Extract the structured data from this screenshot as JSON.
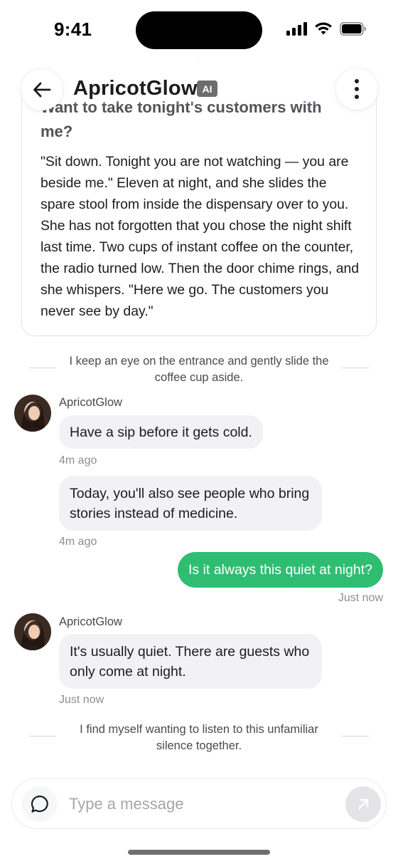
{
  "status_bar": {
    "time": "9:41"
  },
  "header": {
    "title": "ApricotGlow",
    "badge": "AI"
  },
  "intro_card": {
    "title": "Want to take tonight's customers with me?",
    "body": "\"Sit down. Tonight you are not watching — you are beside me.\" Eleven at night, and she slides the spare stool from inside the dispensary over to you. She has not forgotten that you chose the night shift last time. Two cups of instant coffee on the counter, the radio turned low. Then the door chime rings, and she whispers. \"Here we go. The customers you never see by day.\""
  },
  "narrations": [
    "I keep an eye on the entrance and gently slide the coffee cup aside.",
    "I find myself wanting to listen to this unfamiliar silence together."
  ],
  "messages": [
    {
      "sender": "ApricotGlow",
      "text": "Have a sip before it gets cold.",
      "time": "4m ago"
    },
    {
      "text": "Today, you'll also see people who bring stories instead of medicine.",
      "time": "4m ago"
    },
    {
      "text": "Is it always this quiet at night?",
      "time": "Just now"
    },
    {
      "sender": "ApricotGlow",
      "text": "It's usually quiet. There are guests who only come at night.",
      "time": "Just now"
    }
  ],
  "composer": {
    "placeholder": "Type a message"
  },
  "icons": {
    "back": "arrow-left-icon",
    "more": "more-vertical-icon",
    "chat": "chat-bubble-icon",
    "send": "send-arrow-icon"
  },
  "colors": {
    "accent": "#2fbd72",
    "bubble_in": "#f2f2f4",
    "badge": "#6d6d6d"
  }
}
